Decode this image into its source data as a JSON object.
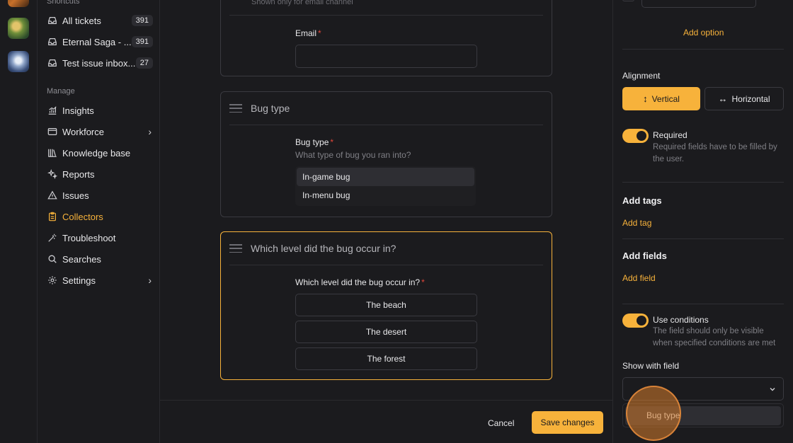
{
  "rail": {
    "games": [
      "game-1",
      "game-2",
      "game-3"
    ]
  },
  "sidebar": {
    "shortcuts_label": "Shortcuts",
    "shortcuts": [
      {
        "label": "All tickets",
        "count": "391",
        "icon": "inbox-icon"
      },
      {
        "label": "Eternal Saga - ...",
        "count": "391",
        "icon": "inbox-icon"
      },
      {
        "label": "Test issue inbox...",
        "count": "27",
        "icon": "inbox-icon"
      }
    ],
    "manage_label": "Manage",
    "manage": [
      {
        "label": "Insights",
        "icon": "chart-icon"
      },
      {
        "label": "Workforce",
        "icon": "window-icon",
        "chevron": "›"
      },
      {
        "label": "Knowledge base",
        "icon": "library-icon"
      },
      {
        "label": "Reports",
        "icon": "sparkle-icon"
      },
      {
        "label": "Issues",
        "icon": "warning-icon"
      },
      {
        "label": "Collectors",
        "icon": "clipboard-icon",
        "active": true
      },
      {
        "label": "Troubleshoot",
        "icon": "wand-icon"
      },
      {
        "label": "Searches",
        "icon": "search-icon"
      },
      {
        "label": "Settings",
        "icon": "gear-icon",
        "chevron": "›"
      }
    ]
  },
  "main": {
    "email_card": {
      "top_hint": "Shown only for email channel",
      "field_label": "Email",
      "required_mark": "*"
    },
    "bug_card": {
      "title": "Bug type",
      "field_label": "Bug type",
      "required_mark": "*",
      "hint": "What type of bug you ran into?",
      "options": [
        "In-game bug",
        "In-menu bug"
      ]
    },
    "level_card": {
      "title": "Which level did the bug occur in?",
      "field_label": "Which level did the bug occur in?",
      "required_mark": "*",
      "options": [
        "The beach",
        "The desert",
        "The forest"
      ]
    },
    "footer": {
      "cancel": "Cancel",
      "save": "Save changes"
    }
  },
  "panel": {
    "add_option": "Add option",
    "alignment_label": "Alignment",
    "alignment_vertical": "Vertical",
    "alignment_vertical_glyph": "↕",
    "alignment_horizontal": "Horizontal",
    "alignment_horizontal_glyph": "↔",
    "required_title": "Required",
    "required_desc": "Required fields have to be filled by the user.",
    "add_tags_heading": "Add tags",
    "add_tag_link": "Add tag",
    "add_fields_heading": "Add fields",
    "add_field_link": "Add field",
    "conditions_title": "Use conditions",
    "conditions_desc": "The field should only be visible when specified conditions are met",
    "show_with_field_label": "Show with field",
    "dropdown_option": "Bug type"
  },
  "colors": {
    "accent": "#f7b23b",
    "background": "#1b1b1e",
    "border": "#3a3a40",
    "required": "#e0463a"
  }
}
